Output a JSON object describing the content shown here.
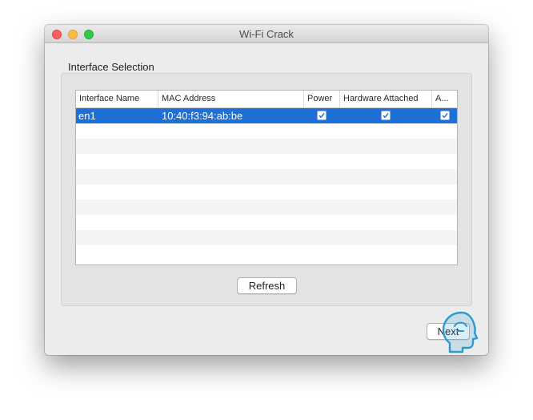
{
  "window": {
    "title": "Wi-Fi Crack"
  },
  "interface_selection": {
    "label": "Interface Selection",
    "columns": [
      "Interface Name",
      "MAC Address",
      "Power",
      "Hardware Attached",
      "A..."
    ],
    "rows": [
      {
        "interface_name": "en1",
        "mac_address": "10:40:f3:94:ab:be",
        "power": true,
        "hardware_attached": true,
        "available": true,
        "selected": true
      }
    ],
    "refresh_label": "Refresh"
  },
  "footer": {
    "next_label": "Next"
  },
  "colors": {
    "selection": "#1e6fd6",
    "close": "#fc605c",
    "minimize": "#fdbc40",
    "zoom": "#34c84a",
    "watermark": "#2a9bd0"
  },
  "icons": {
    "checkbox": "checkmark-icon",
    "watermark": "head-profile-icon"
  }
}
